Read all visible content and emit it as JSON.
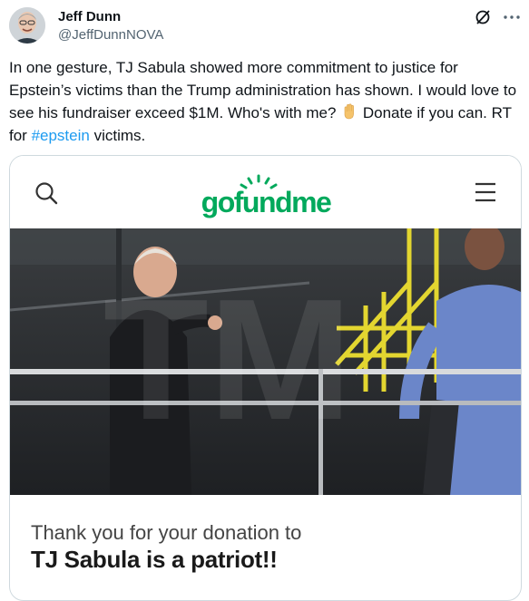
{
  "tweet": {
    "author_name": "Jeff Dunn",
    "author_handle": "@JeffDunnNOVA",
    "text_part1": "In one gesture, TJ Sabula showed more commitment to justice for Epstein’s victims than the Trump administration has shown. I would love to see his fundraiser exceed $1M. Who's with me? ",
    "text_part2": " Donate if you can. RT for ",
    "hashtag": "#epstein",
    "text_part3": " victims.",
    "emoji": "raised-hand-emoji",
    "icons": [
      "grok-slash-icon",
      "more-options-icon"
    ]
  },
  "card": {
    "header_logo": "gofundme",
    "header_icons": [
      "search-icon",
      "menu-icon"
    ],
    "thanks_text": "Thank you for your donation to",
    "campaign_title": "TJ Sabula is a patriot!!"
  },
  "colors": {
    "link": "#1d9bf0",
    "gofundme_green": "#02a95c",
    "handle_gray": "#536471"
  }
}
